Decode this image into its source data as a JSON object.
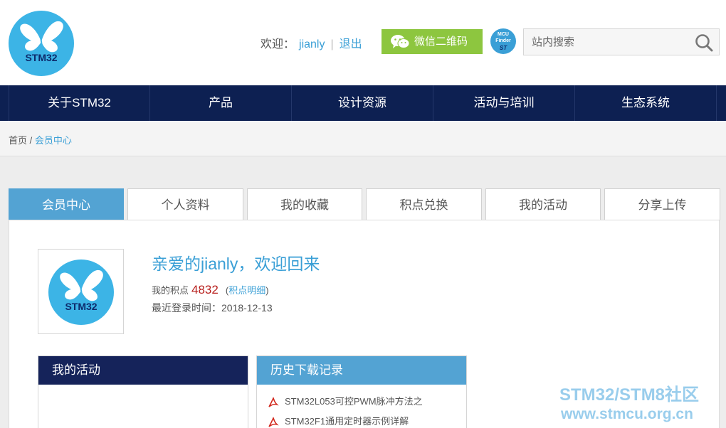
{
  "header": {
    "logo_text": "STM32",
    "welcome_label": "欢迎：",
    "username": "jianly",
    "separator": "|",
    "logout": "退出",
    "wechat_qr": "微信二维码",
    "mcu_finder_line1": "MCU",
    "mcu_finder_line2": "Finder",
    "mcu_finder_brand": "ST",
    "search_placeholder": "站内搜索"
  },
  "nav": {
    "items": [
      "关于STM32",
      "产品",
      "设计资源",
      "活动与培训",
      "生态系统"
    ]
  },
  "breadcrumb": {
    "home": "首页",
    "sep": "/",
    "current": "会员中心"
  },
  "tabs": [
    "会员中心",
    "个人资料",
    "我的收藏",
    "积点兑换",
    "我的活动",
    "分享上传"
  ],
  "active_tab": 0,
  "profile": {
    "avatar_text": "STM32",
    "greeting": "亲爱的jianly，欢迎回来",
    "points_label": "我的积点",
    "points_value": "4832",
    "points_detail_open": "(",
    "points_detail": "积点明细",
    "points_detail_close": ")",
    "last_login": "最近登录时间：2018-12-13"
  },
  "activity_box": {
    "title": "我的活动"
  },
  "history_box": {
    "title": "历史下载记录",
    "items": [
      "STM32L053可控PWM脉冲方法之",
      "STM32F1通用定时器示例详解"
    ]
  },
  "watermark": {
    "line1": "STM32/STM8社区",
    "line2": "www.stmcu.org.cn"
  },
  "colors": {
    "brand_blue": "#3cb4e6",
    "nav_navy": "#0d2052",
    "link_blue": "#3a9fd6",
    "wechat_green": "#8dc63f",
    "points_red": "#b8201e"
  }
}
